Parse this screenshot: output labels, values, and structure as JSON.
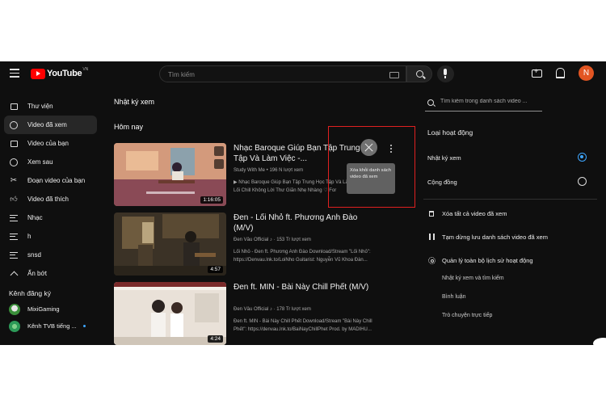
{
  "header": {
    "logo_text": "YouTube",
    "logo_region": "VN",
    "search_placeholder": "Tìm kiếm",
    "avatar_letter": "N"
  },
  "sidebar": {
    "items": [
      {
        "label": "Thư viện",
        "icon": "library-icon",
        "active": false
      },
      {
        "label": "Video đã xem",
        "icon": "history-icon",
        "active": true
      },
      {
        "label": "Video của bạn",
        "icon": "your-videos-icon",
        "active": false
      },
      {
        "label": "Xem sau",
        "icon": "watch-later-icon",
        "active": false
      },
      {
        "label": "Đoạn video của bạn",
        "icon": "clips-icon",
        "active": false
      },
      {
        "label": "Video đã thích",
        "icon": "liked-icon",
        "active": false
      },
      {
        "label": "Nhạc",
        "icon": "playlist-icon",
        "active": false
      },
      {
        "label": "h",
        "icon": "playlist-icon",
        "active": false
      },
      {
        "label": "snsd",
        "icon": "playlist-icon",
        "active": false
      },
      {
        "label": "Ẩn bớt",
        "icon": "chevron-up-icon",
        "active": false
      }
    ],
    "subscriptions_heading": "Kênh đăng ký",
    "subscriptions": [
      {
        "name": "MixiGaming",
        "color": "#3a8f3a"
      },
      {
        "name": "Kênh TVB tiếng ...",
        "color": "#2c9a58",
        "live": true
      }
    ]
  },
  "main": {
    "title": "Nhật ký xem",
    "section": "Hôm nay",
    "videos": [
      {
        "title": "Nhạc Baroque Giúp Bạn Tập Trung Học Tập Và Làm Việc -...",
        "channel": "Study With Me • 196 N lượt xem",
        "desc_line1": "▶ Nhạc Baroque Giúp Bạn Tập Trung Học Tập Và Làm",
        "desc_line2": "Lối Chill Không Lời Thư Giãn Nhẹ Nhàng ♡ For",
        "duration": "1:16:05"
      },
      {
        "title": "Đen - Lối Nhỏ ft. Phương Anh Đào (M/V)",
        "channel": "Đen Vâu Official ♪ · 153 Tr lượt xem",
        "desc_line1": "Lối Nhỏ - Đen ft. Phương Anh Đào Download/Stream \"Lối Nhỏ\":",
        "desc_line2": "https://Denvau.lnk.to/LoiNho Guitarist: Nguyễn Vũ Khoa Đàn...",
        "duration": "4:57"
      },
      {
        "title": "Đen ft. MIN - Bài Này Chill Phết (M/V)",
        "channel": "Đen Vâu Official ♪ · 178 Tr lượt xem",
        "desc_line1": "Đen ft. MIN - Bài Này Chill Phết Download/Stream \"Bài Này Chill",
        "desc_line2": "Phết\": https://denvau.lnk.to/BaiNayChillPhet Prod. by MADIHU...",
        "duration": "4:24"
      }
    ],
    "remove_tooltip": "Xóa khỏi danh sách video đã xem"
  },
  "right_panel": {
    "search_placeholder": "Tìm kiếm trong danh sách video ...",
    "activity_type_heading": "Loại hoạt động",
    "options": [
      {
        "label": "Nhật ký xem",
        "selected": true
      },
      {
        "label": "Cộng đồng",
        "selected": false
      }
    ],
    "actions": [
      {
        "label": "Xóa tất cả video đã xem",
        "icon": "trash-icon"
      },
      {
        "label": "Tạm dừng lưu danh sách video đã xem",
        "icon": "pause-icon"
      },
      {
        "label": "Quản lý toàn bộ lịch sử hoạt động",
        "icon": "gear-icon"
      }
    ],
    "sub_links": [
      "Nhật ký xem và tìm kiếm",
      "Bình luận",
      "Trò chuyện trực tiếp"
    ]
  },
  "colors": {
    "background": "#0f0f0f",
    "accent": "#3ea6ff",
    "brand_red": "#ff0000",
    "highlight_box": "#e02020",
    "avatar": "#e25522"
  }
}
